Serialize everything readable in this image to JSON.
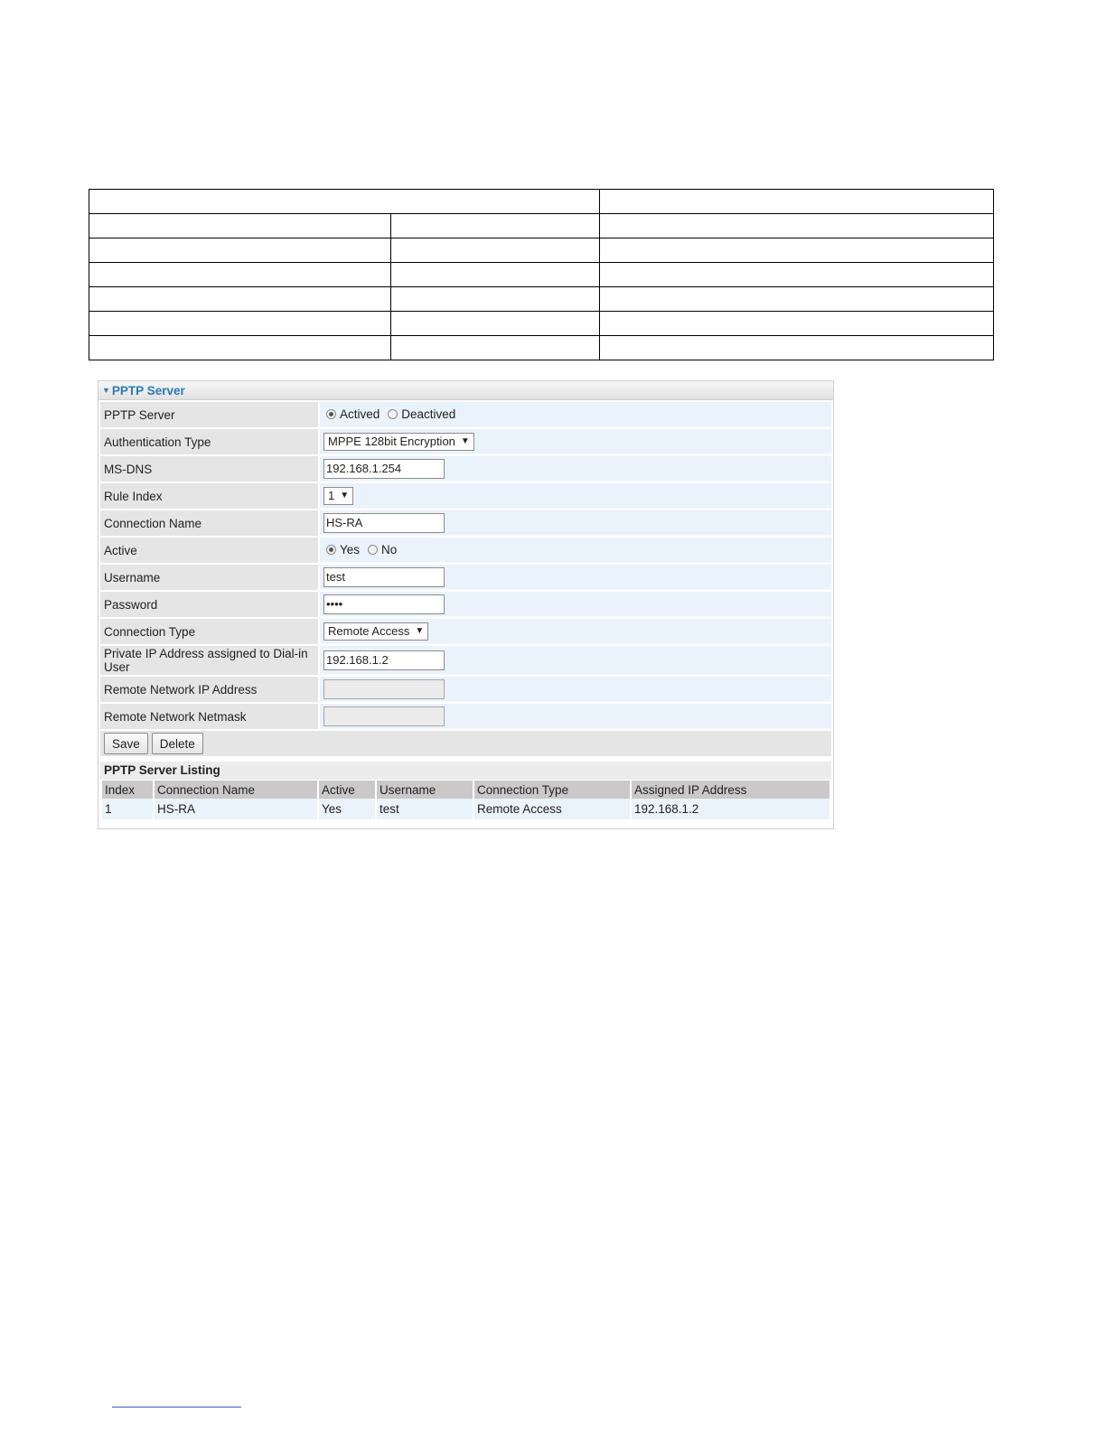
{
  "panel": {
    "title": "PPTP Server"
  },
  "form": {
    "pptp_server": {
      "label": "PPTP Server",
      "options": [
        "Actived",
        "Deactived"
      ],
      "selected": "Actived"
    },
    "auth_type": {
      "label": "Authentication Type",
      "value": "MPPE 128bit Encryption"
    },
    "ms_dns": {
      "label": "MS-DNS",
      "value": "192.168.1.254"
    },
    "rule_index": {
      "label": "Rule Index",
      "value": "1"
    },
    "connection_name": {
      "label": "Connection Name",
      "value": "HS-RA"
    },
    "active": {
      "label": "Active",
      "options": [
        "Yes",
        "No"
      ],
      "selected": "Yes"
    },
    "username": {
      "label": "Username",
      "value": "test"
    },
    "password": {
      "label": "Password",
      "value": "••••"
    },
    "connection_type": {
      "label": "Connection Type",
      "value": "Remote Access"
    },
    "private_ip": {
      "label": "Private IP Address assigned to Dial-in User",
      "value": "192.168.1.2"
    },
    "remote_ip": {
      "label": "Remote Network IP Address",
      "value": ""
    },
    "remote_netmask": {
      "label": "Remote Network Netmask",
      "value": ""
    }
  },
  "buttons": {
    "save": "Save",
    "delete": "Delete"
  },
  "listing": {
    "title": "PPTP Server Listing",
    "columns": [
      "Index",
      "Connection Name",
      "Active",
      "Username",
      "Connection Type",
      "Assigned IP Address"
    ],
    "rows": [
      [
        "1",
        "HS-RA",
        "Yes",
        "test",
        "Remote Access",
        "192.168.1.2"
      ]
    ]
  },
  "colors": {
    "header_text": "#2a7ab8",
    "label_bg": "#e5e5e5",
    "value_bg": "#eaf2fb"
  }
}
